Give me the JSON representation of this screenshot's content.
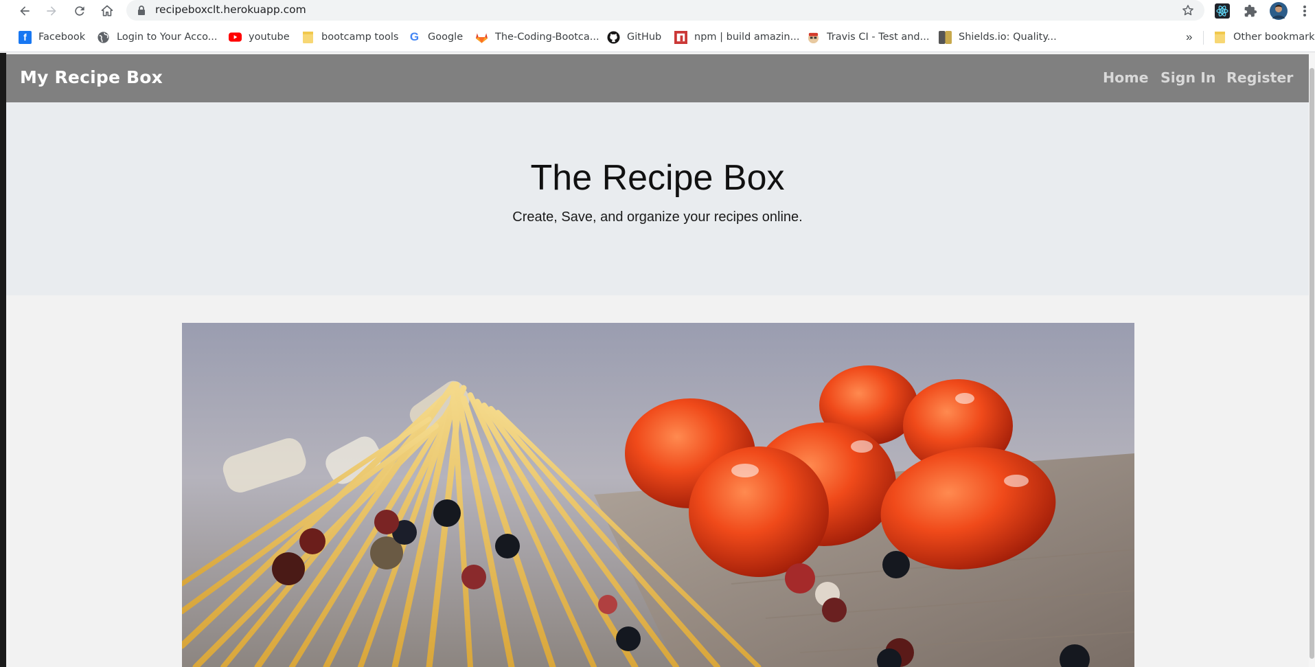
{
  "browser": {
    "url": "recipeboxclt.herokuapp.com",
    "bookmarks": [
      {
        "label": "Facebook",
        "icon": "facebook-icon"
      },
      {
        "label": "Login to Your Acco...",
        "icon": "globe-icon"
      },
      {
        "label": "youtube",
        "icon": "youtube-icon"
      },
      {
        "label": "bootcamp tools",
        "icon": "folder-icon"
      },
      {
        "label": "Google",
        "icon": "google-icon"
      },
      {
        "label": "The-Coding-Bootca...",
        "icon": "gitlab-icon"
      },
      {
        "label": "GitHub",
        "icon": "github-icon"
      },
      {
        "label": "npm | build amazin...",
        "icon": "npm-icon"
      },
      {
        "label": "Travis CI - Test and...",
        "icon": "travis-icon"
      },
      {
        "label": "Shields.io: Quality...",
        "icon": "shields-icon"
      }
    ],
    "overflow_label": "»",
    "other_bookmarks": "Other bookmarks"
  },
  "site": {
    "brand": "My Recipe Box",
    "nav": [
      "Home",
      "Sign In",
      "Register"
    ]
  },
  "hero": {
    "title": "The Recipe Box",
    "subtitle": "Create, Save, and organize your recipes online."
  },
  "colors": {
    "navbar": "#808080",
    "jumbotron": "#e9ecef",
    "page_bg": "#f2f2f2"
  }
}
